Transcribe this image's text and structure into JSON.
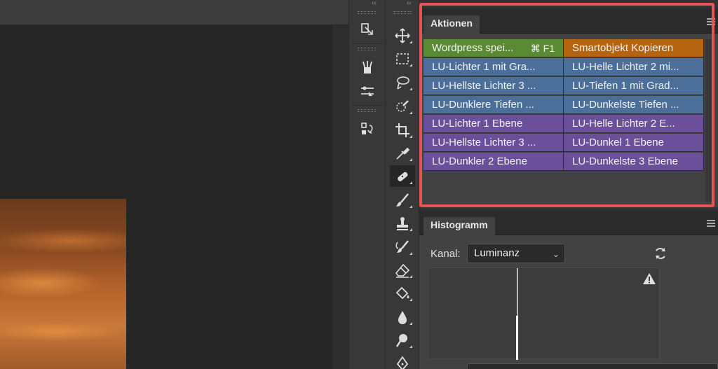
{
  "panels": {
    "actions": {
      "tab_label": "Aktionen",
      "items": [
        {
          "label": "Wordpress spei...",
          "shortcut": "⌘ F1",
          "color": "#5b8a35"
        },
        {
          "label": "Smartobjekt Kopieren",
          "shortcut": "",
          "color": "#b5650f"
        },
        {
          "label": "LU-Lichter 1 mit Gra...",
          "shortcut": "",
          "color": "#4b6f99"
        },
        {
          "label": "LU-Helle Lichter 2 mi...",
          "shortcut": "",
          "color": "#4b6f99"
        },
        {
          "label": "LU-Hellste Lichter 3 ...",
          "shortcut": "",
          "color": "#4b6f99"
        },
        {
          "label": "LU-Tiefen 1 mit Grad...",
          "shortcut": "",
          "color": "#4b6f99"
        },
        {
          "label": "LU-Dunklere Tiefen ...",
          "shortcut": "",
          "color": "#4b6f99"
        },
        {
          "label": "LU-Dunkelste Tiefen ...",
          "shortcut": "",
          "color": "#4b6f99"
        },
        {
          "label": "LU-Lichter 1 Ebene",
          "shortcut": "",
          "color": "#6b4f9a"
        },
        {
          "label": "LU-Helle Lichter 2 E...",
          "shortcut": "",
          "color": "#6b4f9a"
        },
        {
          "label": "LU-Hellste Lichter 3 ...",
          "shortcut": "",
          "color": "#6b4f9a"
        },
        {
          "label": "LU-Dunkel 1 Ebene",
          "shortcut": "",
          "color": "#6b4f9a"
        },
        {
          "label": "LU-Dunkler 2 Ebene",
          "shortcut": "",
          "color": "#6b4f9a"
        },
        {
          "label": "LU-Dunkelste 3 Ebene",
          "shortcut": "",
          "color": "#6b4f9a"
        }
      ]
    },
    "histogram": {
      "tab_label": "Histogramm",
      "channel_label": "Kanal:",
      "channel_value": "Luminanz"
    }
  },
  "panel_icons": [
    "properties-icon",
    "brush-presets-icon",
    "adjustments-icon",
    "history-icon"
  ],
  "tools": [
    "move-tool-icon",
    "marquee-tool-icon",
    "lasso-tool-icon",
    "quick-selection-tool-icon",
    "crop-tool-icon",
    "eyedropper-tool-icon",
    "healing-brush-tool-icon",
    "brush-tool-icon",
    "clone-stamp-tool-icon",
    "history-brush-tool-icon",
    "eraser-tool-icon",
    "paint-bucket-tool-icon",
    "blur-tool-icon",
    "dodge-tool-icon",
    "pen-tool-icon"
  ],
  "colors": {
    "highlight": "#e65550",
    "panel": "#424242",
    "accent_green": "#5b8a35",
    "accent_orange": "#b5650f",
    "accent_blue": "#4b6f99",
    "accent_purple": "#6b4f9a"
  }
}
